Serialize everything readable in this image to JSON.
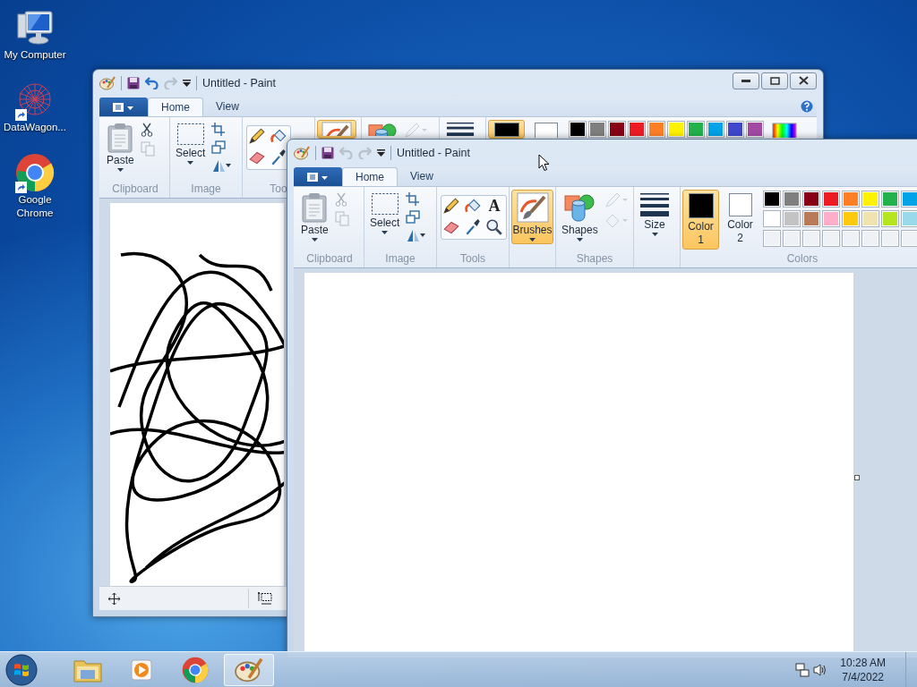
{
  "desktop_icons": [
    {
      "kind": "computer",
      "label": "My Computer",
      "shortcut": false
    },
    {
      "kind": "network",
      "label": "DataWagon...",
      "shortcut": true
    },
    {
      "kind": "chrome",
      "label": "Google Chrome",
      "shortcut": true
    }
  ],
  "windows": [
    {
      "title": "Untitled - Paint",
      "controls": [
        {
          "kind": "minimize"
        },
        {
          "kind": "restore"
        },
        {
          "kind": "close"
        }
      ],
      "quick_access": [
        {
          "kind": "save",
          "disabled": false
        },
        {
          "kind": "undo",
          "disabled": false
        },
        {
          "kind": "redo",
          "disabled": true
        }
      ],
      "tabs": [
        {
          "label": "Home",
          "selected": true
        },
        {
          "label": "View",
          "selected": false
        }
      ],
      "groups": [
        {
          "label": "Clipboard",
          "big": [
            {
              "kind": "paste",
              "label": "Paste"
            }
          ],
          "small": [
            {
              "kind": "cut",
              "disabled": false
            },
            {
              "kind": "copy",
              "disabled": true
            }
          ]
        },
        {
          "label": "Image",
          "big": [
            {
              "kind": "select",
              "label": "Select"
            }
          ],
          "small": [
            {
              "kind": "crop",
              "disabled": false
            },
            {
              "kind": "resize",
              "disabled": false
            },
            {
              "kind": "rotate",
              "disabled": false
            }
          ]
        },
        {
          "label": "Too",
          "tools": [
            {
              "kind": "pencil"
            },
            {
              "kind": "bucket"
            },
            {
              "kind": "eraser"
            },
            {
              "kind": "picker"
            }
          ]
        },
        {
          "big": [
            {
              "kind": "brushes",
              "selected": true
            }
          ]
        },
        {
          "big": [
            {
              "kind": "shapes"
            }
          ],
          "small": [
            {
              "kind": "outline",
              "disabled": true
            }
          ]
        },
        {
          "big": [
            {
              "kind": "size"
            }
          ]
        },
        {
          "big": [
            {
              "kind": "color",
              "selected": true,
              "color": "#000000"
            },
            {
              "kind": "color",
              "selected": false,
              "color": "#ffffff"
            }
          ],
          "palette": [
            [
              {
                "color": "#000000"
              },
              {
                "color": "#7f7f7f"
              },
              {
                "color": "#880015"
              },
              {
                "color": "#ed1c24"
              },
              {
                "color": "#ff7f27"
              },
              {
                "color": "#fff200"
              },
              {
                "color": "#22b14c"
              },
              {
                "color": "#00a2e8"
              },
              {
                "color": "#3f48cc"
              },
              {
                "color": "#a349a4"
              }
            ]
          ],
          "edit_colors": true
        }
      ],
      "canvas": {
        "kind": "scribble"
      },
      "status_bar": true
    },
    {
      "title": "Untitled - Paint",
      "quick_access": [
        {
          "kind": "save",
          "disabled": false
        },
        {
          "kind": "undo",
          "disabled": true
        },
        {
          "kind": "redo",
          "disabled": true
        }
      ],
      "tabs": [
        {
          "label": "Home",
          "selected": true
        },
        {
          "label": "View",
          "selected": false
        }
      ],
      "groups": [
        {
          "label": "Clipboard",
          "big": [
            {
              "kind": "paste",
              "label": "Paste"
            }
          ],
          "small": [
            {
              "kind": "cut",
              "disabled": true
            },
            {
              "kind": "copy",
              "disabled": true
            }
          ]
        },
        {
          "label": "Image",
          "big": [
            {
              "kind": "select",
              "label": "Select"
            }
          ],
          "small": [
            {
              "kind": "crop",
              "disabled": false
            },
            {
              "kind": "resize",
              "disabled": false
            },
            {
              "kind": "rotate",
              "disabled": false
            }
          ]
        },
        {
          "label": "Tools",
          "tools": [
            {
              "kind": "pencil"
            },
            {
              "kind": "bucket"
            },
            {
              "kind": "text",
              "label": "A"
            },
            {
              "kind": "eraser"
            },
            {
              "kind": "picker"
            },
            {
              "kind": "magnifier"
            }
          ]
        },
        {
          "big": [
            {
              "kind": "brushes",
              "label": "Brushes",
              "selected": true
            }
          ]
        },
        {
          "label": "Shapes",
          "big": [
            {
              "kind": "shapes",
              "label": "Shapes"
            }
          ],
          "small": [
            {
              "kind": "outline",
              "disabled": true
            },
            {
              "kind": "fill",
              "disabled": true
            }
          ]
        },
        {
          "big": [
            {
              "kind": "size",
              "label": "Size"
            }
          ]
        },
        {
          "label": "Colors",
          "big": [
            {
              "kind": "color",
              "label": "Color 1",
              "selected": true,
              "color": "#000000"
            },
            {
              "kind": "color",
              "label": "Color 2",
              "selected": false,
              "color": "#ffffff"
            }
          ],
          "palette": [
            [
              {
                "color": "#000000"
              },
              {
                "color": "#7f7f7f"
              },
              {
                "color": "#880015"
              },
              {
                "color": "#ed1c24"
              },
              {
                "color": "#ff7f27"
              },
              {
                "color": "#fff200"
              },
              {
                "color": "#22b14c"
              },
              {
                "color": "#00a2e8"
              }
            ],
            [
              {
                "color": "#ffffff"
              },
              {
                "color": "#c3c3c3"
              },
              {
                "color": "#b97a57"
              },
              {
                "color": "#ffaec9"
              },
              {
                "color": "#ffc90e"
              },
              {
                "color": "#efe4b0"
              },
              {
                "color": "#b5e61d"
              },
              {
                "color": "#99d9ea"
              }
            ],
            [
              {
                "kind": "empty"
              },
              {
                "kind": "empty"
              },
              {
                "kind": "empty"
              },
              {
                "kind": "empty"
              },
              {
                "kind": "empty"
              },
              {
                "kind": "empty"
              },
              {
                "kind": "empty"
              },
              {
                "kind": "empty"
              }
            ]
          ]
        }
      ],
      "canvas": {
        "kind": "blank"
      }
    }
  ],
  "taskbar": {
    "items": [
      {
        "kind": "explorer",
        "active": false
      },
      {
        "kind": "media",
        "active": false
      },
      {
        "kind": "chrome",
        "active": false
      },
      {
        "kind": "paint",
        "active": true
      }
    ],
    "clock": {
      "time": "10:28 AM",
      "date": "7/4/2022"
    }
  }
}
